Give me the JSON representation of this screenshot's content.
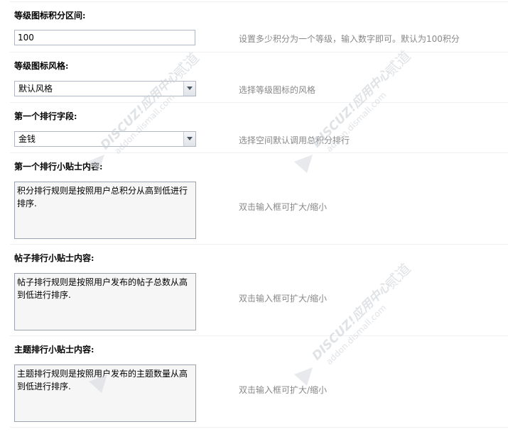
{
  "fields": [
    {
      "label": "等级图标积分区间:",
      "type": "input",
      "value": "100",
      "tip": "设置多少积分为一个等级，输入数字即可。默认为100积分"
    },
    {
      "label": "等级图标风格:",
      "type": "select",
      "value": "默认风格",
      "tip": "选择等级图标的风格"
    },
    {
      "label": "第一个排行字段:",
      "type": "select",
      "value": "金钱",
      "tip": "选择空间默认调用总积分排行"
    },
    {
      "label": "第一个排行小贴士内容:",
      "type": "textarea",
      "value": "积分排行规则是按照用户总积分从高到低进行排序.",
      "tip": "双击输入框可扩大/缩小"
    },
    {
      "label": "帖子排行小贴士内容:",
      "type": "textarea",
      "value": "帖子排行规则是按照用户发布的帖子总数从高到低进行排序.",
      "tip": "双击输入框可扩大/缩小"
    },
    {
      "label": "主题排行小贴士内容:",
      "type": "textarea",
      "value": "主题排行规则是按照用户发布的主题数量从高到低进行排序.",
      "tip": "双击输入框可扩大/缩小"
    }
  ],
  "watermark": {
    "brand": "DISCUZ!应用中心",
    "site": "addon.dismall.com",
    "mark": "贰道"
  },
  "icons": {
    "dropdown": "chevron-down-icon"
  }
}
